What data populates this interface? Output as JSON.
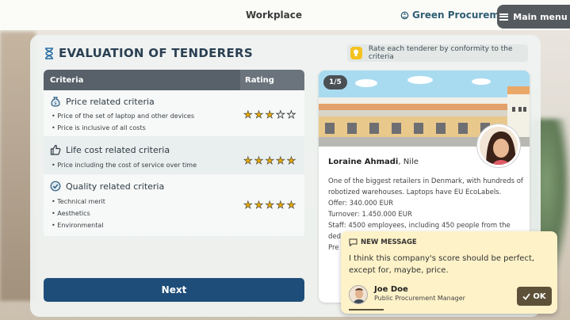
{
  "header": {
    "title": "Workplace",
    "green_procurement": "Green Procurement",
    "menu_label": "Main menu"
  },
  "evaluation": {
    "title": "EVALUATION OF TENDERERS",
    "hint": "Rate each tenderer by conformity to the criteria"
  },
  "table": {
    "col_criteria": "Criteria",
    "col_rating": "Rating",
    "criteria": [
      {
        "icon": "money-bag-icon",
        "label": "Price related criteria",
        "bullets": [
          "Price of the set of laptop and other devices",
          "Price is inclusive of all costs"
        ],
        "rating": 3,
        "max": 5
      },
      {
        "icon": "thumbs-up-icon",
        "label": "Life cost related criteria",
        "bullets": [
          "Price including the cost of service over time"
        ],
        "rating": 5,
        "max": 5
      },
      {
        "icon": "badge-check-icon",
        "label": "Quality related criteria",
        "bullets": [
          "Technical merit",
          "Aesthetics",
          "Environmental"
        ],
        "rating": 5,
        "max": 5
      }
    ]
  },
  "next_label": "Next",
  "tenderer": {
    "counter": "1/5",
    "name": "Loraine Ahmadi",
    "company": ", Nile",
    "description": "One of the biggest retailers in Denmark, with hundreds of robotized warehouses. Laptops have EU EcoLabels.",
    "offer": "Offer: 340.000 EUR",
    "turnover": "Turnover: 1.450.000 EUR",
    "staff": "Staff: 4500 employees, including 450 people from the",
    "more1": "ded",
    "more2": "Pre"
  },
  "message": {
    "header": "NEW MESSAGE",
    "text": "I think this company's score should be perfect, except for, maybe, price.",
    "sender_name": "Joe Doe",
    "sender_role": "Public Procurement Manager",
    "ok_label": "OK"
  },
  "colors": {
    "accent": "#1f4d79",
    "star": "#e6a800",
    "header_dark": "#58616a",
    "message_bg": "#fdf2c8"
  }
}
